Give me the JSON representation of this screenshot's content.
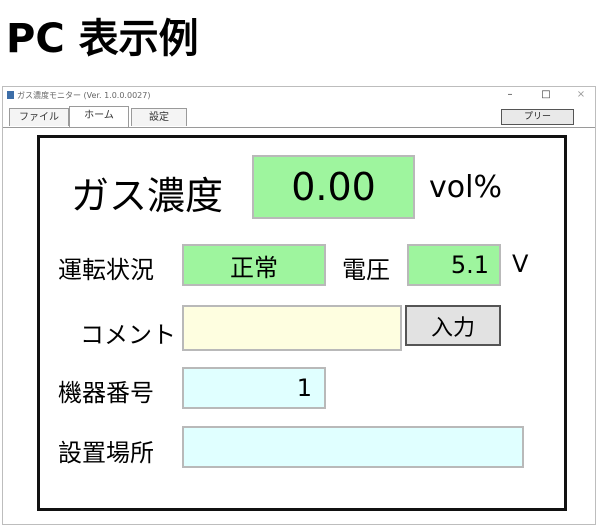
{
  "heading": "PC 表示例",
  "window": {
    "title": "ガス濃度モニター (Ver. 1.0.0.0027)",
    "minimize": "–",
    "maximize": "□",
    "close": "×"
  },
  "tabs": [
    {
      "label": "ファイル"
    },
    {
      "label": "ホーム"
    },
    {
      "label": "設定"
    }
  ],
  "toolbar": {
    "right_button": "プリー"
  },
  "main": {
    "gas_label": "ガス濃度",
    "gas_value": "0.00",
    "gas_unit": "vol%",
    "status_label": "運転状況",
    "status_value": "正常",
    "voltage_label": "電圧",
    "voltage_value": "5.1",
    "voltage_unit": "V",
    "comment_label": "コメント",
    "comment_value": "",
    "input_button": "入力",
    "device_label": "機器番号",
    "device_value": "1",
    "location_label": "設置場所",
    "location_value": ""
  },
  "colors": {
    "value_green": "#9ef59e",
    "comment_cream": "#fefee0",
    "field_cyan": "#e0ffff"
  }
}
